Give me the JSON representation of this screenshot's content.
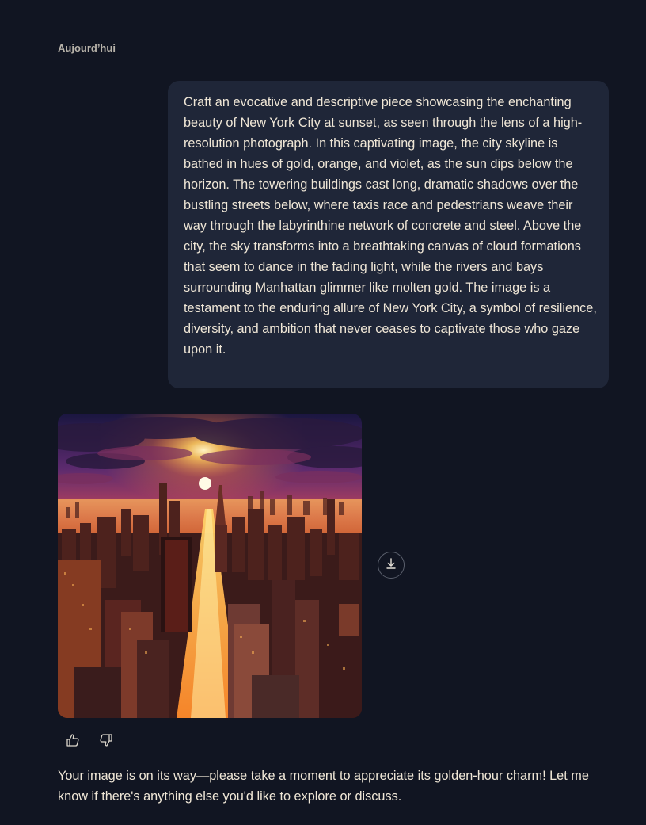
{
  "conversation": {
    "day_label": "Aujourd’hui",
    "user_message": "Craft an evocative and descriptive piece showcasing the enchanting beauty of New York City at sunset, as seen through the lens of a high-resolution photograph. In this captivating image, the city skyline is bathed in hues of gold, orange, and violet, as the sun dips below the horizon. The towering buildings cast long, dramatic shadows over the bustling streets below, where taxis race and pedestrians weave their way through the labyrinthine network of concrete and steel. Above the city, the sky transforms into a breathtaking canvas of cloud formations that seem to dance in the fading light, while the rivers and bays surrounding Manhattan glimmer like molten gold. The image is a testament to the enduring allure of New York City, a symbol of resilience, diversity, and ambition that never ceases to captivate those who gaze upon it.",
    "assistant_message": "Your image is on its way—please take a moment to appreciate its golden-hour charm! Let me know if there's anything else you'd like to explore or discuss."
  },
  "icons": {
    "download": "download-icon",
    "like": "thumbs-up-icon",
    "dislike": "thumbs-down-icon"
  },
  "colors": {
    "background": "#111522",
    "user_bubble": "#1f2638",
    "text": "#efe6d6",
    "divider": "#3a3f4f"
  }
}
